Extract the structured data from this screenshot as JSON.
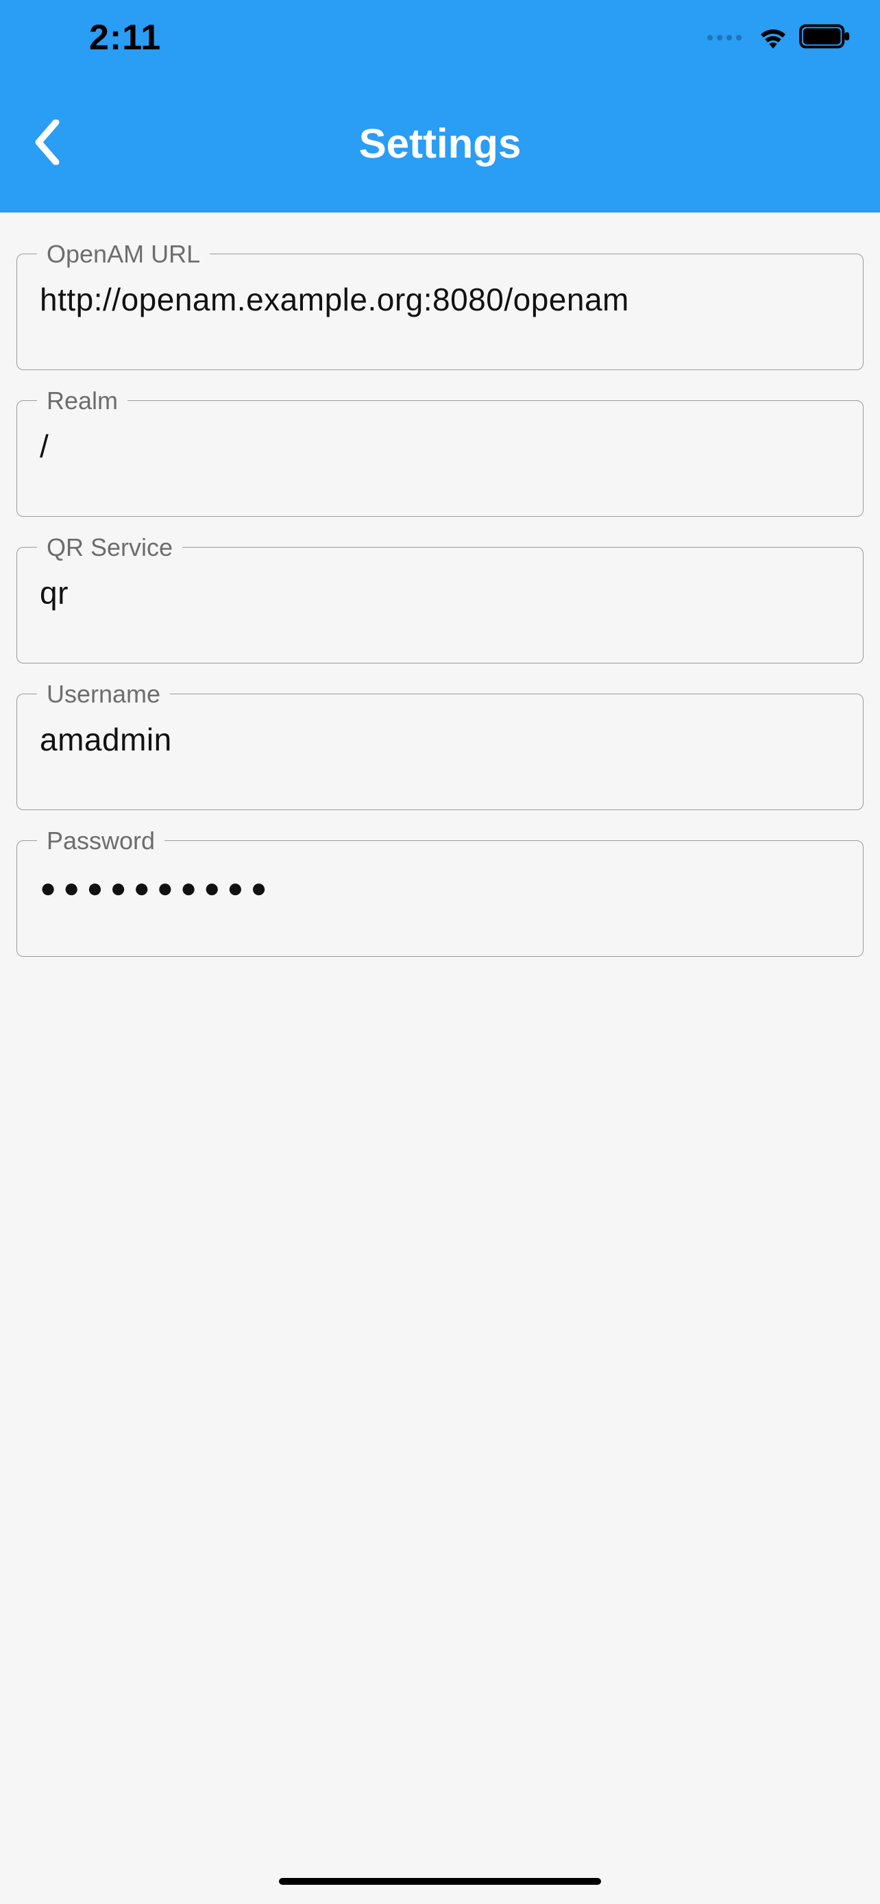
{
  "status": {
    "time": "2:11"
  },
  "nav": {
    "title": "Settings"
  },
  "fields": {
    "openam_url": {
      "label": "OpenAM URL",
      "value": "http://openam.example.org:8080/openam"
    },
    "realm": {
      "label": "Realm",
      "value": "/"
    },
    "qr_service": {
      "label": "QR Service",
      "value": "qr"
    },
    "username": {
      "label": "Username",
      "value": "amadmin"
    },
    "password": {
      "label": "Password",
      "value": "●●●●●●●●●●"
    }
  }
}
